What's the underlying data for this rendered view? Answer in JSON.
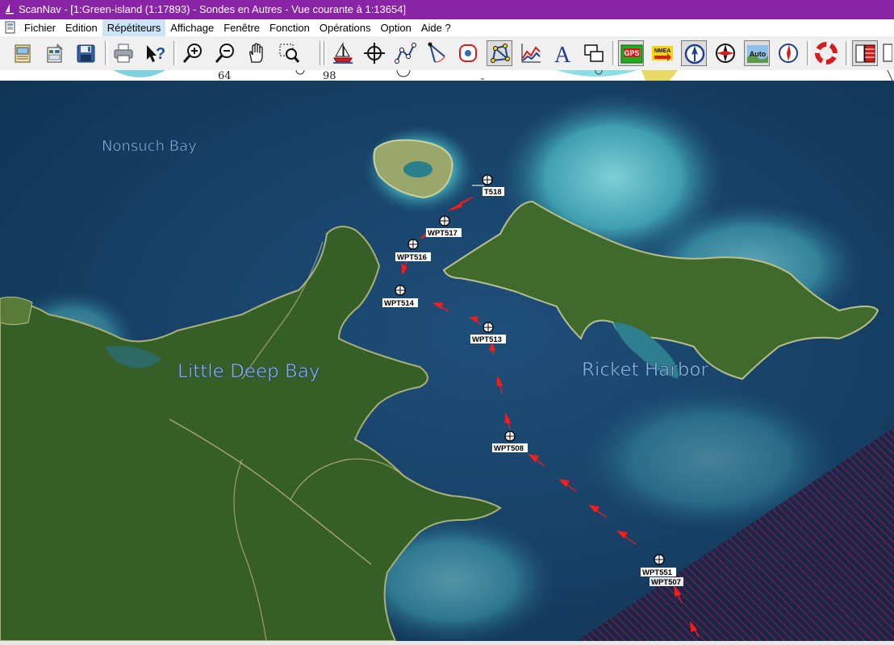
{
  "window": {
    "title": "ScanNav - [1:Green-island (1:17893) - Sondes en  Autres  - Vue courante à 1:13654]"
  },
  "menu": {
    "items": [
      {
        "id": "fichier",
        "label": "Fichier"
      },
      {
        "id": "edition",
        "label": "Edition"
      },
      {
        "id": "repetiteurs",
        "label": "Répétiteurs"
      },
      {
        "id": "affichage",
        "label": "Affichage"
      },
      {
        "id": "fenetre",
        "label": "Fenêtre"
      },
      {
        "id": "fonction",
        "label": "Fonction"
      },
      {
        "id": "operations",
        "label": "Opérations"
      },
      {
        "id": "option",
        "label": "Option"
      },
      {
        "id": "aide",
        "label": "Aide ?"
      }
    ],
    "active": "repetiteurs"
  },
  "toolbar": {
    "buttons": [
      {
        "id": "new-chart",
        "icon": "chart-document-icon"
      },
      {
        "id": "chart-properties",
        "icon": "chart-properties-icon"
      },
      {
        "id": "save",
        "icon": "floppy-disk-icon"
      },
      {
        "id": "print",
        "icon": "printer-icon"
      },
      {
        "id": "context-help",
        "icon": "help-arrow-icon"
      },
      {
        "id": "zoom-in",
        "icon": "zoom-in-icon"
      },
      {
        "id": "zoom-out",
        "icon": "zoom-out-icon"
      },
      {
        "id": "pan",
        "icon": "hand-icon"
      },
      {
        "id": "zoom-rect",
        "icon": "zoom-rectangle-icon"
      },
      {
        "id": "boat",
        "icon": "sailboat-icon"
      },
      {
        "id": "waypoint",
        "icon": "waypoint-crosshair-icon"
      },
      {
        "id": "route",
        "icon": "route-icon"
      },
      {
        "id": "measure",
        "icon": "compass-divider-icon"
      },
      {
        "id": "target",
        "icon": "target-icon"
      },
      {
        "id": "route-edit",
        "icon": "route-network-icon"
      },
      {
        "id": "graph",
        "icon": "graph-icon"
      },
      {
        "id": "text",
        "icon": "text-icon"
      },
      {
        "id": "windows",
        "icon": "windows-icon"
      },
      {
        "id": "gps",
        "icon": "gps-icon",
        "label": "GPS"
      },
      {
        "id": "nmea",
        "icon": "nmea-icon",
        "label": "NMEA"
      },
      {
        "id": "north-up",
        "icon": "north-up-icon"
      },
      {
        "id": "compass",
        "icon": "compass-rose-icon"
      },
      {
        "id": "auto",
        "icon": "auto-icon",
        "label": "Auto"
      },
      {
        "id": "heading",
        "icon": "heading-icon"
      },
      {
        "id": "lifebuoy",
        "icon": "lifebuoy-icon"
      },
      {
        "id": "layers",
        "icon": "layers-icon"
      }
    ]
  },
  "ruler": {
    "marks": [
      "64",
      "98"
    ]
  },
  "map": {
    "places": {
      "nonsuch": "Nonsuch Bay",
      "little_deep": "Little Deep Bay",
      "ricket": "Ricket Harbor"
    },
    "waypoints": {
      "w518": "T518",
      "w517": "WPT517",
      "w516": "WPT516",
      "w514": "WPT514",
      "w513": "WPT513",
      "w508": "WPT508",
      "w551": "WPT551",
      "w507": "WPT507"
    },
    "colors": {
      "route": "#ff1a1a",
      "hatch": "#c21d4a"
    }
  }
}
